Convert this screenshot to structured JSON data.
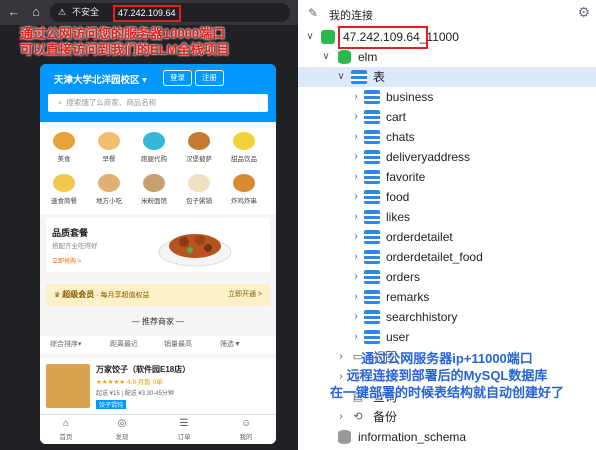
{
  "browser": {
    "url": "47.242.109.64",
    "insecure_label": "不安全",
    "back_icon": "back-arrow-icon",
    "home_icon": "home-icon"
  },
  "phone": {
    "location": "天津大学北洋园校区",
    "login_label": "登录",
    "register_label": "注册",
    "search_placeholder": "搜索饿了么商家、商品名称",
    "categories": [
      "美食",
      "早餐",
      "跑腿代购",
      "汉堡披萨",
      "甜品饮品",
      "速食简餐",
      "地方小吃",
      "米粉面馆",
      "包子粥铺",
      "炸鸡炸串"
    ],
    "promo": {
      "title": "品质套餐",
      "subtitle": "搭配齐全吃得好",
      "link": "立即抢购 >"
    },
    "vip": {
      "name": "超级会员",
      "desc": "· 每月享超值权益",
      "action": "立即开通 >"
    },
    "section_title": "推荐商家",
    "sort_options": [
      "综合排序▾",
      "距离最近",
      "销量最高",
      "筛选▼"
    ],
    "shop": {
      "name": "万家饺子（软件园E18店）",
      "rating": "★★★★★ 4.9 月售 0单",
      "meta": "起送 ¥15 | 配送 ¥3 30-45分钟",
      "tag": "饺子馄饨"
    },
    "tabs": [
      "首页",
      "发现",
      "订单",
      "我的"
    ]
  },
  "annotations": {
    "top_red": [
      "通过公网访问您的服务器10000端口",
      "可以直接访问到我们的ELM全栈项目"
    ],
    "bottom_blue": [
      "通过公网服务器ip+11000端口",
      "远程连接到部署后的MySQL数据库",
      "在一键部署的时候表结构就自动创建好了"
    ]
  },
  "connections": {
    "title": "我的连接",
    "host": "47.242.109.64",
    "port_suffix": "_11000",
    "database": "elm",
    "tables_group": "表",
    "tables": [
      "business",
      "cart",
      "chats",
      "deliveryaddress",
      "favorite",
      "food",
      "likes",
      "orderdetailet",
      "orderdetailet_food",
      "orders",
      "remarks",
      "searchhistory",
      "user"
    ],
    "other_groups": [
      "视图",
      "函数",
      "查询",
      "备份"
    ],
    "other_database": "information_schema"
  },
  "colors": {
    "accent": "#0097ff",
    "highlight_red": "#e02020",
    "annotation_blue": "#2563d6",
    "tree_selection": "#dbe9fb"
  }
}
